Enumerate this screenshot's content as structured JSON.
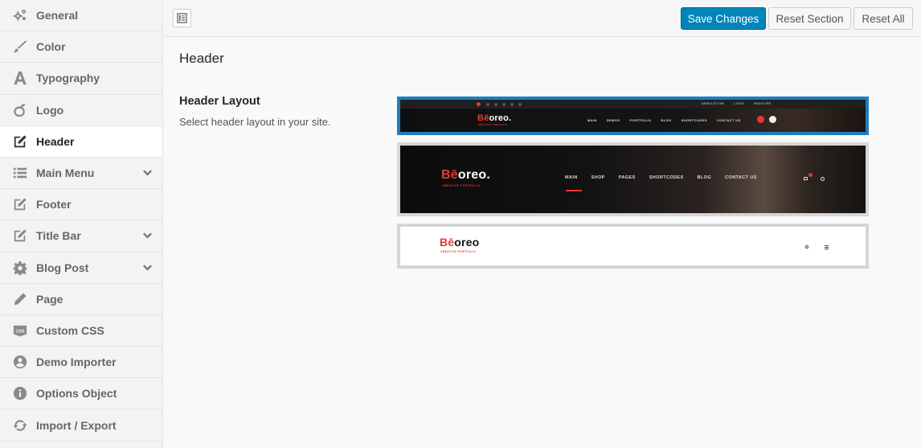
{
  "sidebar": {
    "items": [
      {
        "label": "General",
        "icon": "gears-icon"
      },
      {
        "label": "Color",
        "icon": "brush-icon"
      },
      {
        "label": "Typography",
        "icon": "font-icon"
      },
      {
        "label": "Logo",
        "icon": "logo-icon"
      },
      {
        "label": "Header",
        "icon": "edit-icon"
      },
      {
        "label": "Main Menu",
        "icon": "list-icon"
      },
      {
        "label": "Footer",
        "icon": "edit-icon"
      },
      {
        "label": "Title Bar",
        "icon": "edit-icon"
      },
      {
        "label": "Blog Post",
        "icon": "gear-icon"
      },
      {
        "label": "Page",
        "icon": "pencil-icon"
      },
      {
        "label": "Custom CSS",
        "icon": "css-icon"
      },
      {
        "label": "Demo Importer",
        "icon": "user-circle-icon"
      },
      {
        "label": "Options Object",
        "icon": "info-icon"
      },
      {
        "label": "Import / Export",
        "icon": "refresh-icon"
      }
    ],
    "active": "Header",
    "expandable": [
      "Main Menu",
      "Title Bar",
      "Blog Post"
    ]
  },
  "toolbar": {
    "save_label": "Save Changes",
    "reset_section_label": "Reset Section",
    "reset_all_label": "Reset All"
  },
  "section": {
    "title": "Header"
  },
  "field": {
    "title": "Header Layout",
    "description": "Select header layout in your site."
  },
  "layouts": {
    "selected_index": 0,
    "brand_prefix": "Bē",
    "brand_suffix": "oreo",
    "brand_period": ".",
    "brand_tagline": "CREATIVE PORTFOLIO",
    "layout1": {
      "top_links": [
        "NEWSLETTER",
        "LOGIN",
        "REGISTER"
      ],
      "nav": [
        "MAIN",
        "DEMOS",
        "PORTFOLIO",
        "BLOG",
        "SHORTCODES",
        "CONTACT US"
      ]
    },
    "layout2": {
      "nav": [
        "MAIN",
        "SHOP",
        "PAGES",
        "SHORTCODES",
        "BLOG",
        "CONTACT US"
      ],
      "cart_count": "0"
    }
  },
  "colors": {
    "primary": "#0085ba",
    "selected_border": "#1e7ec0",
    "brand_red": "#e53935"
  }
}
